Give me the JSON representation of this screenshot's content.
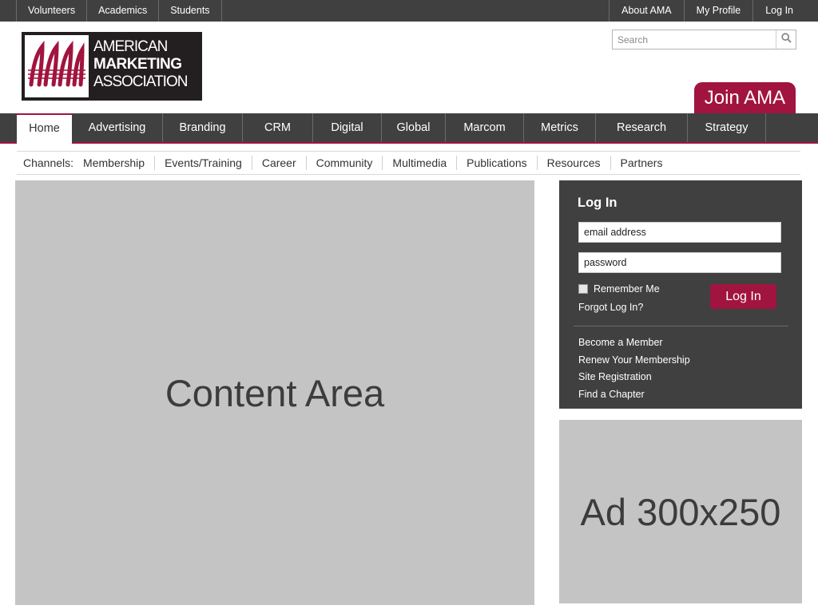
{
  "topbar": {
    "left": [
      "Volunteers",
      "Academics",
      "Students"
    ],
    "right": [
      "About AMA",
      "My Profile",
      "Log In"
    ]
  },
  "header": {
    "logo": {
      "line1": "AMERICAN",
      "line2": "MARKETING",
      "line3": "ASSOCIATION",
      "brand_color": "#a1143f"
    },
    "search": {
      "placeholder": "Search",
      "icon": "search-icon"
    },
    "join_label": "Join AMA"
  },
  "nav": {
    "items": [
      "Home",
      "Advertising",
      "Branding",
      "CRM",
      "Digital",
      "Global",
      "Marcom",
      "Metrics",
      "Research",
      "Strategy"
    ],
    "active": "Home"
  },
  "channels": {
    "label": "Channels:",
    "items": [
      "Membership",
      "Events/Training",
      "Career",
      "Community",
      "Multimedia",
      "Publications",
      "Resources",
      "Partners"
    ]
  },
  "content": {
    "label": "Content Area"
  },
  "login": {
    "title": "Log In",
    "email_placeholder": "email address",
    "password_placeholder": "password",
    "remember_label": "Remember Me",
    "forgot_label": "Forgot Log In?",
    "submit_label": "Log In",
    "links": [
      "Become a Member",
      "Renew Your Membership",
      "Site Registration",
      "Find a Chapter"
    ]
  },
  "ad": {
    "label": "Ad 300x250"
  }
}
